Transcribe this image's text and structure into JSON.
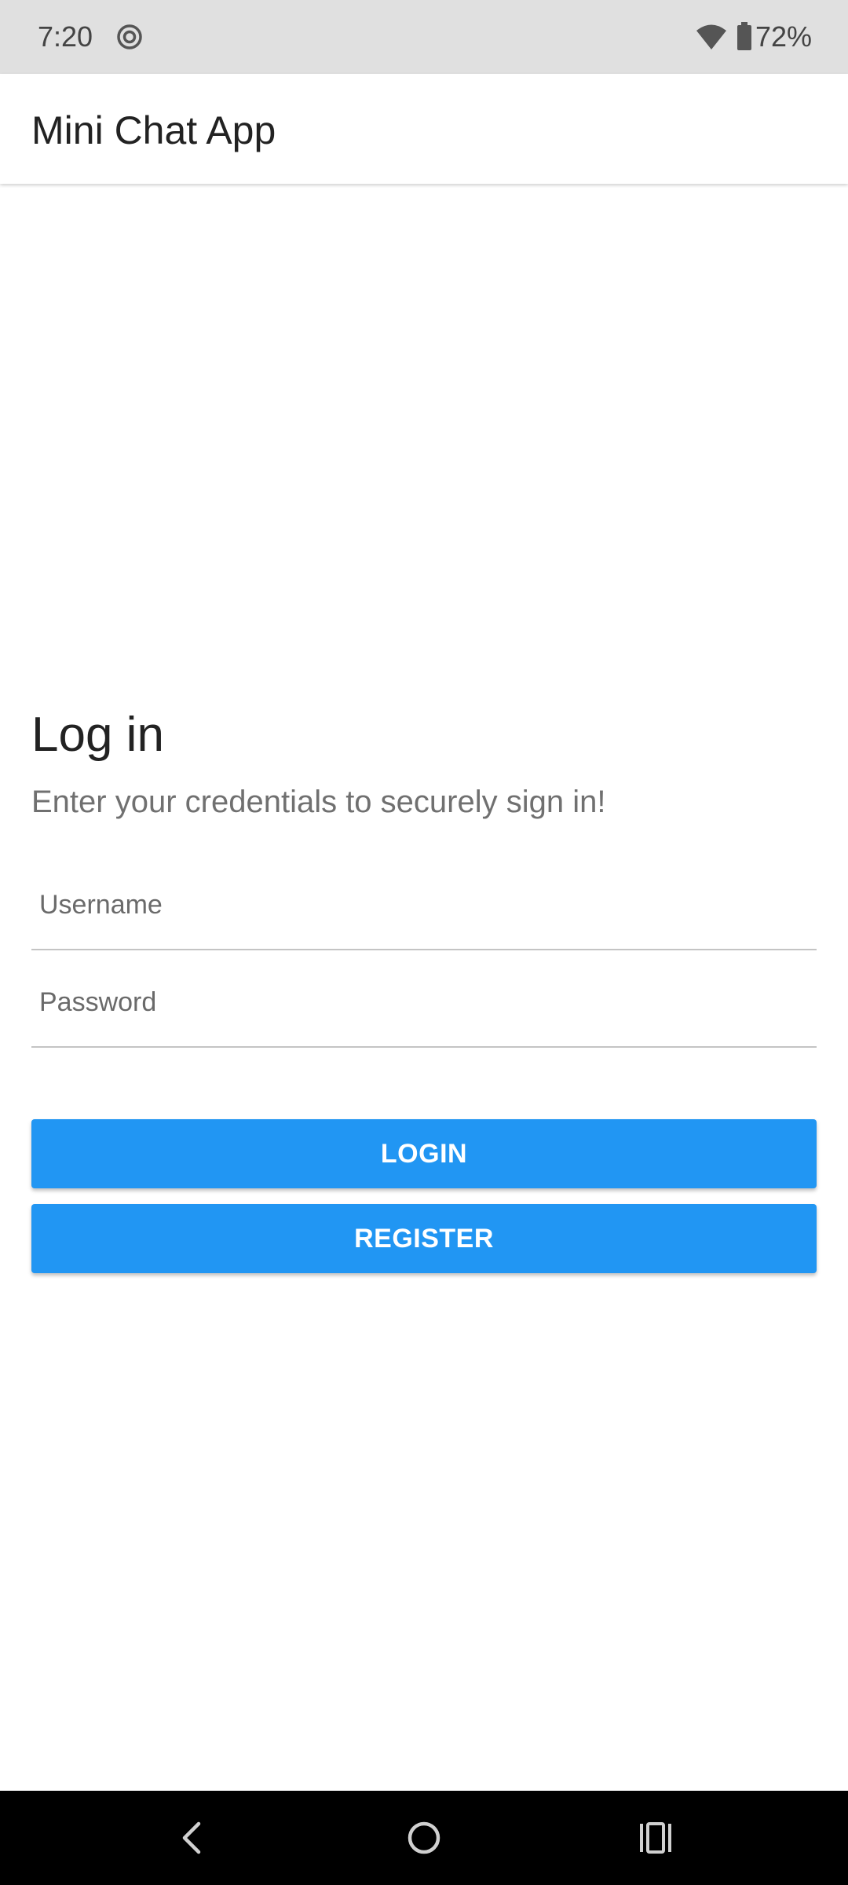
{
  "status_bar": {
    "time": "7:20",
    "battery_percent": "72%",
    "icons": [
      "record-icon",
      "wifi-icon",
      "battery-icon"
    ]
  },
  "app_bar": {
    "title": "Mini Chat App"
  },
  "login": {
    "heading": "Log in",
    "subtitle": "Enter your credentials to securely sign in!",
    "username_placeholder": "Username",
    "username_value": "",
    "password_placeholder": "Password",
    "password_value": "",
    "login_label": "LOGIN",
    "register_label": "REGISTER"
  },
  "nav_bar": {
    "icons": [
      "back-icon",
      "home-icon",
      "recents-icon"
    ]
  },
  "colors": {
    "accent": "#2196f3",
    "status_bar": "#e0e0e0",
    "nav_bar": "#000000"
  }
}
